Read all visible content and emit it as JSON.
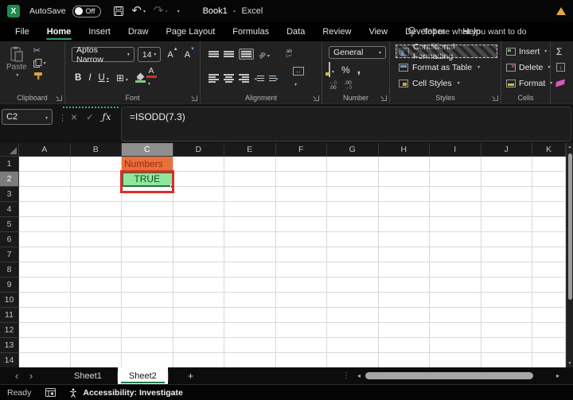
{
  "titlebar": {
    "autosave_label": "AutoSave",
    "autosave_state": "Off",
    "doc_title": "Book1",
    "title_separator": "-",
    "app_name": "Excel"
  },
  "menu_tabs": [
    "File",
    "Home",
    "Insert",
    "Draw",
    "Page Layout",
    "Formulas",
    "Data",
    "Review",
    "View",
    "Developer",
    "Help"
  ],
  "active_tab_index": 1,
  "search_label": "Tell me what you want to do",
  "ribbon": {
    "clipboard": {
      "label": "Clipboard",
      "paste": "Paste"
    },
    "font": {
      "label": "Font",
      "name": "Aptos Narrow",
      "size": "14",
      "bold": "B",
      "italic": "I",
      "underline": "U"
    },
    "alignment": {
      "label": "Alignment"
    },
    "number": {
      "label": "Number",
      "format": "General",
      "percent": "%",
      "comma": ","
    },
    "styles": {
      "label": "Styles",
      "conditional_formatting": "Conditional Formatting",
      "format_as_table": "Format as Table",
      "cell_styles": "Cell Styles"
    },
    "cells": {
      "label": "Cells",
      "insert": "Insert",
      "delete": "Delete",
      "format": "Format"
    },
    "editing": {
      "autosum": "Σ"
    }
  },
  "formula_bar": {
    "name_box": "C2",
    "cancel": "×",
    "enter": "✓",
    "fx": "ƒx",
    "formula": "=ISODD(7.3)"
  },
  "grid": {
    "columns": [
      "A",
      "B",
      "C",
      "D",
      "E",
      "F",
      "G",
      "H",
      "I",
      "J",
      "K"
    ],
    "rows": [
      "1",
      "2",
      "3",
      "4",
      "5",
      "6",
      "7",
      "8",
      "9",
      "10",
      "11",
      "12",
      "13",
      "14"
    ],
    "selected_column": "C",
    "selected_row": "2",
    "selected_cell": "C2",
    "cells": [
      {
        "ref": "C1",
        "value": "Numbers",
        "bg": "#E8713A",
        "color": "#992716",
        "align": "left"
      },
      {
        "ref": "C2",
        "value": "TRUE",
        "bg": "#8FE79B",
        "color": "#174D28",
        "align": "center"
      }
    ],
    "annotation_cell": "C2"
  },
  "sheet_bar": {
    "prev": "‹",
    "next": "›",
    "tabs": [
      "Sheet1",
      "Sheet2"
    ],
    "active": "Sheet2",
    "add_label": "+",
    "overflow_dots": "⋮",
    "scroll_left": "◂",
    "scroll_right": "▸"
  },
  "status_bar": {
    "mode": "Ready",
    "accessibility": "Accessibility: Investigate"
  },
  "icons": {
    "excel_logo": "X",
    "scissors": "✂",
    "undo": "↶",
    "redo": "↷",
    "borders": "⊞",
    "merge_arrows": "↔",
    "wrap_top": "ab",
    "wrap_bottom": "c↵",
    "orientation": "ab",
    "fill_down_arrow": "↓",
    "vscroll_up": "▲",
    "vscroll_down": "▼",
    "inc_dec_top": "←0",
    "inc_dec_bottom": ".00",
    "dec_dec_top": ".00",
    "dec_dec_bottom": "→0",
    "warning_triangle_color": "#E5A83E"
  },
  "colors": {
    "accent_green": "#21A366",
    "tab_underline": "#2E9E6B",
    "annotation_red": "#D93025",
    "cell_orange": "#E8713A",
    "cell_green": "#8FE79B",
    "selection_green": "#1E7145"
  }
}
